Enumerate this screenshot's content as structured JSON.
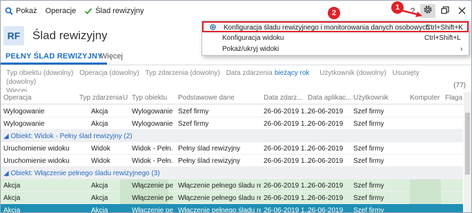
{
  "toolbar": {
    "show_label": "Pokaż",
    "operations_label": "Operacje",
    "audit_label": "Ślad rewizyjny",
    "help_label": "?"
  },
  "header": {
    "badge": "RF",
    "title": "Ślad rewizyjny"
  },
  "tabs": {
    "full_trail": "PEŁNY ŚLAD REWIZYJNY",
    "more": "Więcej"
  },
  "filters": {
    "object_type": "Typ obiektu (dowolny)",
    "operation": "Operacja (dowolny)",
    "event_type": "Typ zdarzenia (dowolny)",
    "event_date_label": "Data zdarzenia",
    "event_date_value": "bieżący rok",
    "user": "Użytkownik (dowolny)",
    "deleted": "Usunięty (dowolny)",
    "more": "Więcej",
    "count": "(77)"
  },
  "grid": {
    "columns": [
      "Operacja",
      "Typ zdarzenia",
      "U",
      "Typ obiektu",
      "Podstawowe dane",
      "Data zdarz...",
      "Data aplikac...",
      "Użytkownik",
      "Komputer",
      "Flaga"
    ],
    "rows": [
      {
        "kind": "data",
        "op": "Wylogowanie",
        "event": "Akcja",
        "objtype": "Wylogowanie",
        "basic": "Szef firmy",
        "date": "26-06-2019 1...",
        "appdate": "26-06-2019",
        "user": "Szef firmy"
      },
      {
        "kind": "data",
        "op": "Wylogowanie",
        "event": "Akcja",
        "objtype": "Wylogowanie",
        "basic": "Szef firmy",
        "date": "26-06-2019 1...",
        "appdate": "26-06-2019",
        "user": "Szef firmy"
      },
      {
        "kind": "group",
        "label": "Obiekt: Widok - Pełny ślad rewizyjny (2)"
      },
      {
        "kind": "data",
        "op": "Uruchomienie widoku",
        "event": "Widok",
        "objtype": "Widok - Pełn...",
        "basic": "Pełny ślad rewizyjny",
        "date": "26-06-2019 1...",
        "appdate": "26-06-2019",
        "user": "Szef firmy"
      },
      {
        "kind": "data",
        "op": "Uruchomienie widoku",
        "event": "Widok",
        "objtype": "Widok - Pełn...",
        "basic": "Pełny ślad rewizyjny",
        "date": "26-06-2019 1...",
        "appdate": "26-06-2019",
        "user": "Szef firmy"
      },
      {
        "kind": "group",
        "label": "Obiekt: Włączenie pełnego śladu rewizyjnego (3)"
      },
      {
        "kind": "green",
        "op": "Akcja",
        "event": "Akcja",
        "objtype": "Włączenie pe...",
        "basic": "Włączenie pełnego śladu re...",
        "date": "26-06-2019 1...",
        "appdate": "26-06-2019",
        "user": "Szef firmy"
      },
      {
        "kind": "green",
        "op": "Akcja",
        "event": "Akcja",
        "objtype": "Włączenie pe...",
        "basic": "Włączenie pełnego śladu re...",
        "date": "26-06-2019 1...",
        "appdate": "26-06-2019",
        "user": "Szef firmy"
      },
      {
        "kind": "selected",
        "op": "Akcja",
        "event": "Akcja",
        "objtype": "Włączenie pe...",
        "basic": "Włączenie pełnego śladu re...",
        "date": "26-06-2019 1...",
        "appdate": "26-06-2019",
        "user": "Szef firmy"
      }
    ]
  },
  "menu": {
    "items": [
      {
        "label": "Konfiguracja śladu rewizyjnego i monitorowania danych osobowych",
        "shortcut": "Ctrl+Shift+K"
      },
      {
        "label": "Konfiguracja widoku",
        "shortcut": "Ctrl+Shift+L"
      },
      {
        "label": "Pokaż/ukryj widoki",
        "shortcut": "›"
      }
    ]
  },
  "annotations": {
    "badge1": "1",
    "badge2": "2"
  },
  "colors": {
    "accent": "#1b6fc7",
    "highlight": "#e0212a",
    "selected_row": "#1f8fb5",
    "green_row": "#dcefdc"
  },
  "icons": [
    "search-icon",
    "check-icon",
    "gear-icon",
    "restore-icon",
    "close-icon",
    "gear-small-icon"
  ]
}
